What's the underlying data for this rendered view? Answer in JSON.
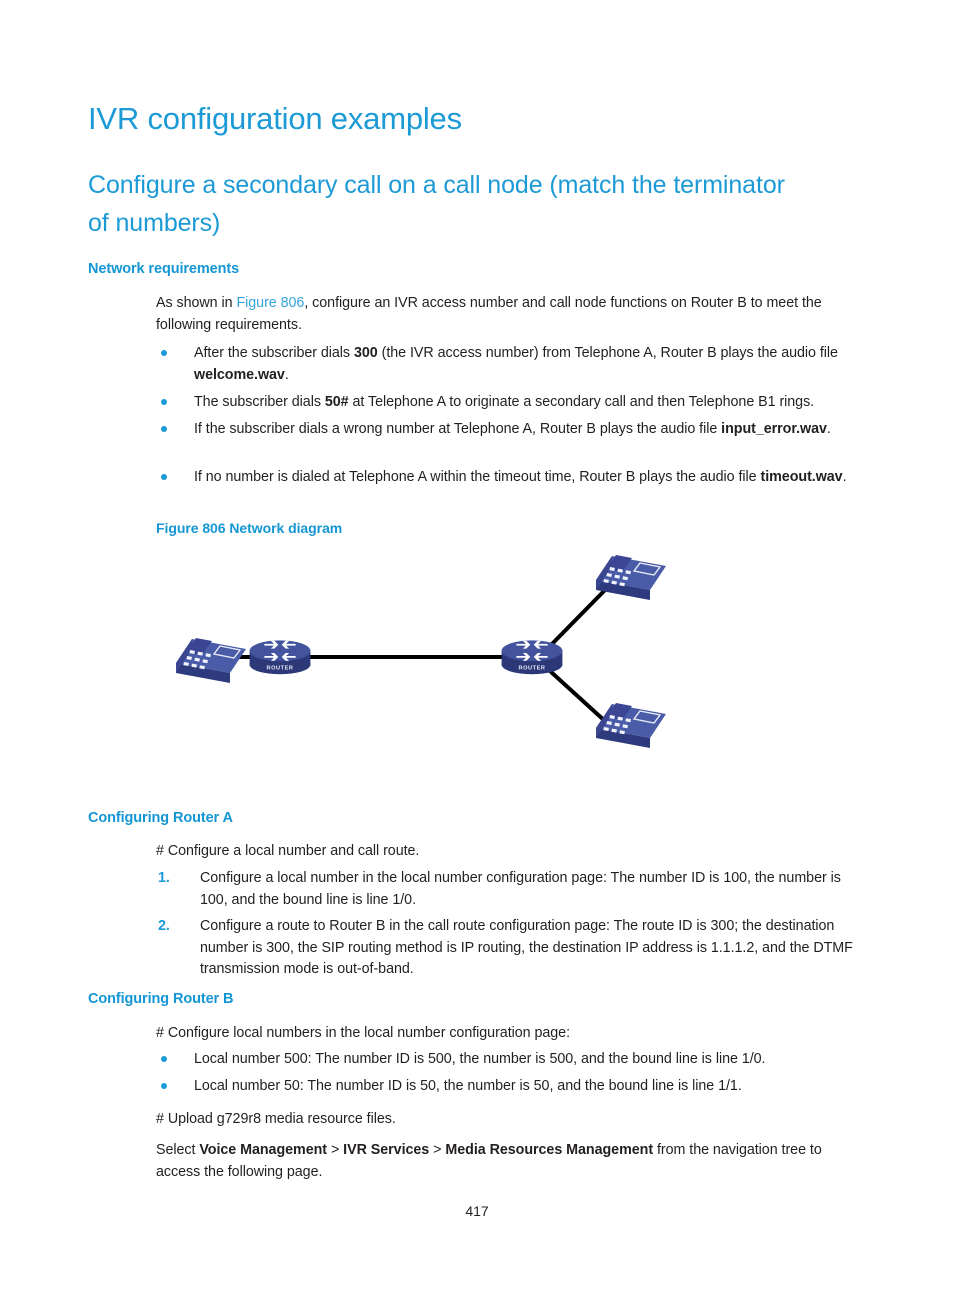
{
  "document": {
    "page_number": "417",
    "colors": {
      "heading_blue": "#1c9ad6",
      "subheading_blue": "#1496d4",
      "bullet_blue": "#1b9ad7",
      "xref_blue": "#34a5dc",
      "body_text": "#231f20",
      "device_blue": "#3b4a96",
      "link_black": "#000000"
    }
  },
  "headings": {
    "h1": "IVR configuration examples",
    "h2": "Configure a secondary call on a call node (match the terminator of numbers)",
    "network_requirements": "Network requirements",
    "configuring_router_a": "Configuring Router A",
    "configuring_router_b": "Configuring Router B"
  },
  "network_requirements": {
    "intro_pre": "As shown in ",
    "intro_xref": "Figure 806",
    "intro_post": ", configure an IVR access number and call node functions on Router B to meet the following requirements.",
    "bullets": [
      {
        "p1": "After the subscriber dials ",
        "b1": "300",
        "p2": " (the IVR access number) from Telephone A, Router B plays the audio file ",
        "b2": "welcome.wav",
        "p3": "."
      },
      {
        "p1": "The subscriber dials ",
        "b1": "50#",
        "p2": " at Telephone A to originate a secondary call and then Telephone B1 rings.",
        "b2": "",
        "p3": ""
      },
      {
        "p1": "If the subscriber dials a wrong number at Telephone A, Router B plays the audio file ",
        "b1": "",
        "p2": "",
        "b2": "input_error.wav",
        "p3": "."
      },
      {
        "p1": "If no number is dialed at Telephone A within the timeout time, Router B plays the audio file ",
        "b1": "",
        "p2": "",
        "b2": "timeout.wav",
        "p3": "."
      }
    ]
  },
  "figure": {
    "caption_number": "Figure 806",
    "caption_text": "Network diagram",
    "caption_full": "Figure 806 Network diagram",
    "device_label_router": "ROUTER",
    "nodes": [
      {
        "name": "telephone-a",
        "type": "telephone"
      },
      {
        "name": "router-a",
        "type": "router",
        "label": "ROUTER"
      },
      {
        "name": "router-b",
        "type": "router",
        "label": "ROUTER"
      },
      {
        "name": "telephone-b1",
        "type": "telephone"
      },
      {
        "name": "telephone-b2",
        "type": "telephone"
      }
    ],
    "links": [
      {
        "from": "telephone-a",
        "to": "router-a"
      },
      {
        "from": "router-a",
        "to": "router-b"
      },
      {
        "from": "router-b",
        "to": "telephone-b1"
      },
      {
        "from": "router-b",
        "to": "telephone-b2"
      }
    ]
  },
  "router_a": {
    "intro": "# Configure a local number and call route.",
    "steps": [
      {
        "number": "1.",
        "text": "Configure a local number in the local number configuration page: The number ID is 100, the number is 100, and the bound line is line 1/0."
      },
      {
        "number": "2.",
        "text": "Configure a route to Router B in the call route configuration page: The route ID is 300; the destination number is 300, the SIP routing method is IP routing, the destination IP address is 1.1.1.2, and the DTMF transmission mode is out-of-band."
      }
    ]
  },
  "router_b": {
    "intro": "# Configure local numbers in the local number configuration page:",
    "bullets": [
      "Local number 500: The number ID is 500, the number is 500, and the bound line is line 1/0.",
      "Local number 50: The number ID is 50, the number is 50, and the bound line is line 1/1."
    ],
    "upload_note": "# Upload g729r8 media resource files.",
    "select_pre": "Select ",
    "select_nav1": "Voice Management",
    "select_sep1": " > ",
    "select_nav2": "IVR Services",
    "select_sep2": " > ",
    "select_nav3": "Media Resources Management",
    "select_post": " from the navigation tree to access the following page."
  }
}
